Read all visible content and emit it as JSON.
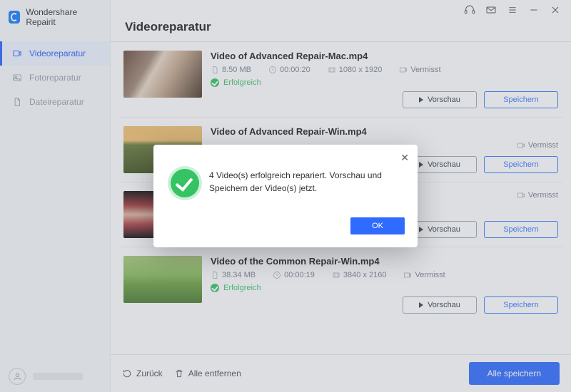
{
  "brand": {
    "name": "Wondershare Repairit"
  },
  "sidebar": {
    "items": [
      {
        "label": "Videoreparatur"
      },
      {
        "label": "Fotoreparatur"
      },
      {
        "label": "Dateireparatur"
      }
    ]
  },
  "header": {
    "title": "Videoreparatur"
  },
  "labels": {
    "missing": "Vermisst",
    "success": "Erfolgreich",
    "preview": "Vorschau",
    "save": "Speichern"
  },
  "videos": [
    {
      "name": "Video of Advanced Repair-Mac.mp4",
      "size": "8.50  MB",
      "duration": "00:00:20",
      "resolution": "1080 x 1920"
    },
    {
      "name": "Video of Advanced Repair-Win.mp4",
      "size": "",
      "duration": "",
      "resolution": ""
    },
    {
      "name": "",
      "size": "",
      "duration": "",
      "resolution": ""
    },
    {
      "name": "Video of the Common Repair-Win.mp4",
      "size": "38.34  MB",
      "duration": "00:00:19",
      "resolution": "3840 x 2160"
    }
  ],
  "footer": {
    "back": "Zurück",
    "remove_all": "Alle entfernen",
    "save_all": "Alle speichern"
  },
  "modal": {
    "message": "4 Video(s) erfolgreich repariert. Vorschau und Speichern der Video(s) jetzt.",
    "ok": "OK"
  }
}
